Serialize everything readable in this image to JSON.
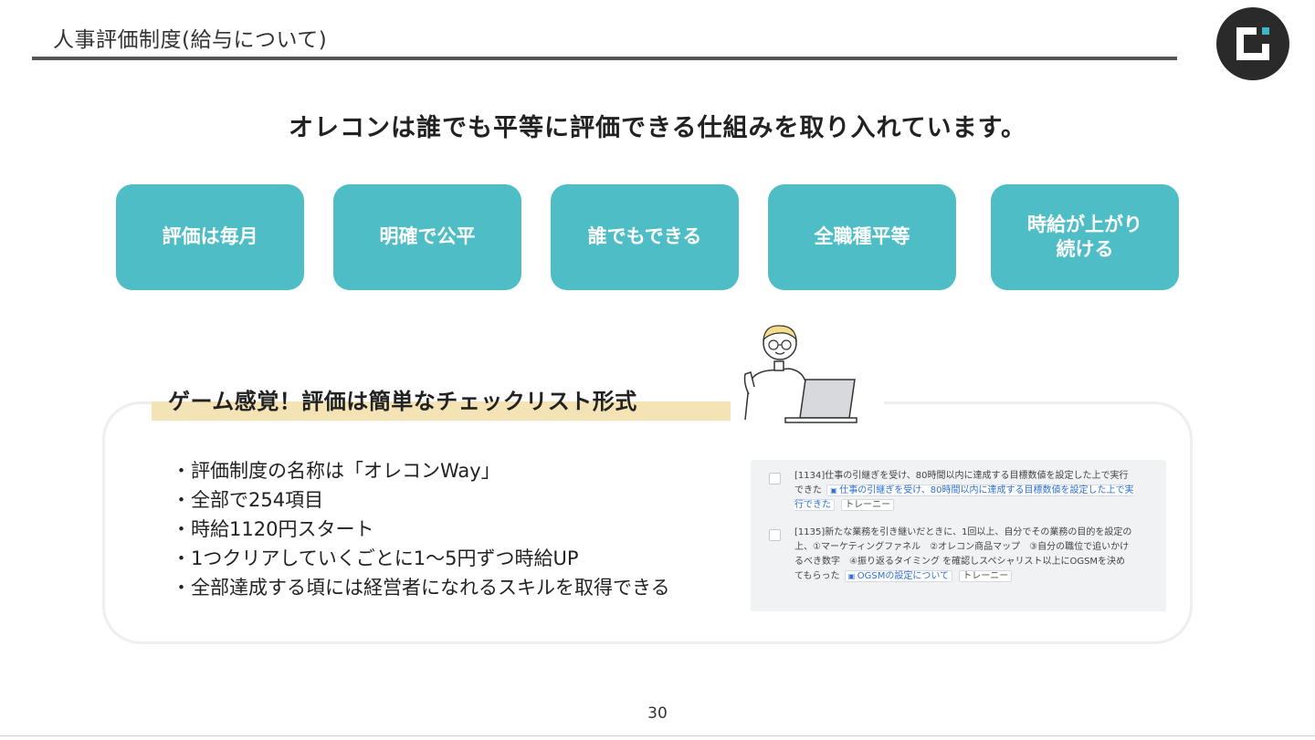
{
  "header": {
    "title": "人事評価制度(給与について)"
  },
  "headline": "オレコンは誰でも平等に評価できる仕組みを取り入れています。",
  "pills": [
    {
      "label": "評価は毎月"
    },
    {
      "label": "明確で公平"
    },
    {
      "label": "誰でもできる"
    },
    {
      "label": "全職種平等"
    },
    {
      "label": "時給が上がり\n続ける"
    }
  ],
  "panel": {
    "subtitle": "ゲーム感覚！評価は簡単なチェックリスト形式",
    "bullets": [
      "・評価制度の名称は「オレコンWay」",
      "・全部で254項目",
      "・時給1120円スタート",
      "・1つクリアしていくごとに1～5円ずつ時給UP",
      "・全部達成する頃には経営者になれるスキルを取得できる"
    ],
    "checklist": [
      {
        "text": "[1134]仕事の引継ぎを受け、80時間以内に達成する目標数値を設定した上で実行できた",
        "link": "仕事の引継ぎを受け、80時間以内に達成する目標数値を設定した上で実行できた",
        "tag": "トレーニー"
      },
      {
        "text": "[1135]新たな業務を引き継いだときに、1回以上、自分でその業務の目的を設定の上、①マーケティングファネル　②オレコン商品マップ　③自分の職位で追いかけるべき数字　④振り返るタイミング を確認しスペシャリスト以上にOGSMを決めてもらった",
        "link": "OGSMの設定について",
        "tag": "トレーニー"
      }
    ]
  },
  "page_number": "30",
  "colors": {
    "pill": "#4ebdc6",
    "subtitle_highlight": "#f4e4b5",
    "logo_bg": "#2a2a2a",
    "logo_accent": "#3fb6c6"
  }
}
